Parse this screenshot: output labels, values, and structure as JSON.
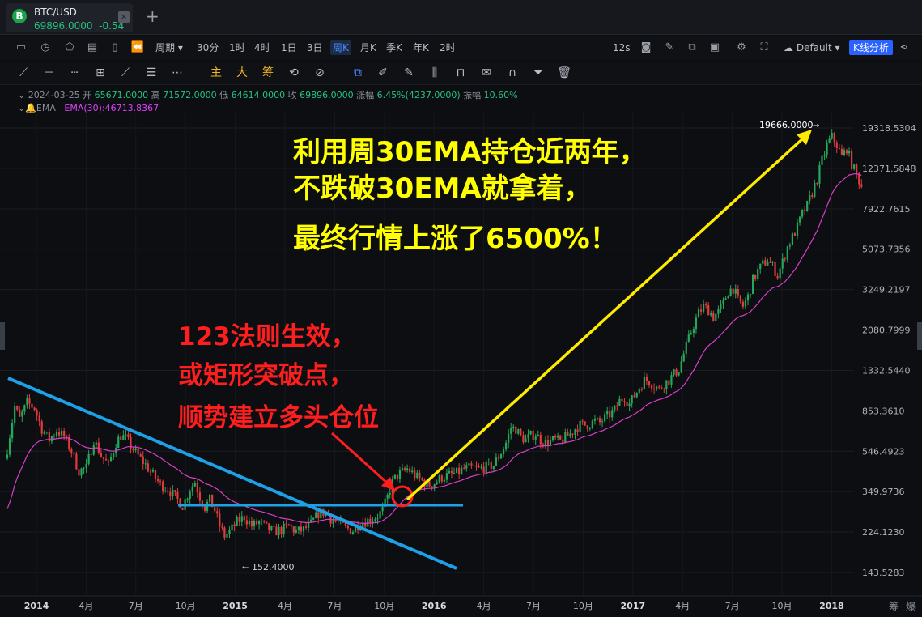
{
  "tab": {
    "symbol": "BTC/USD",
    "price": "69896.0000",
    "change": "-0.54",
    "logo": "B",
    "close": "×",
    "add": "+"
  },
  "toolbar1": {
    "period_label": "周期",
    "intervals": [
      "30分",
      "1时",
      "4时",
      "1日",
      "3日",
      "周K",
      "月K",
      "季K",
      "年K",
      "2时"
    ],
    "active_interval": "周K",
    "countdown": "12s",
    "theme": "Default",
    "kline_button": "K线分析"
  },
  "toolbar2": {
    "main": "主",
    "big": "大",
    "chip": "筹"
  },
  "ohlc": {
    "date": "2024-03-25",
    "open_label": "开",
    "open": "65671.0000",
    "high_label": "高",
    "high": "71572.0000",
    "low_label": "低",
    "low": "64614.0000",
    "close_label": "收",
    "close": "69896.0000",
    "change_label": "涨幅",
    "change": "6.45%(4237.0000)",
    "amp_label": "振幅",
    "amp": "10.60%"
  },
  "ema": {
    "name": "EMA",
    "value": "EMA(30):46713.8367",
    "color": "#e040fb"
  },
  "annotations": {
    "top_lines": [
      "利用周30EMA持仓近两年，",
      "不跌破30EMA就拿着，",
      "最终行情上涨了6500%！"
    ],
    "bottom_lines": [
      "123法则生效，",
      "或矩形突破点，",
      "顺势建立多头仓位"
    ],
    "peak_label": "19666.0000",
    "low_label": "152.4000"
  },
  "corner_labels": [
    "筹",
    "爆"
  ],
  "colors": {
    "up": "#26a85a",
    "down": "#e33b3b",
    "ema": "#d63fc7",
    "trendline": "#1ea0e6",
    "arrow_yellow": "#ffeb00",
    "arrow_red": "#ff1e1e"
  },
  "chart_data": {
    "type": "candlestick",
    "scale": "log",
    "interval": "weekly",
    "y_ticks": [
      19318.5304,
      12371.5848,
      7922.7615,
      5073.7356,
      3249.2197,
      2080.7999,
      1332.544,
      853.361,
      546.4923,
      349.9736,
      224.123,
      143.5283
    ],
    "x_ticks": [
      "2014",
      "4月",
      "7月",
      "10月",
      "2015",
      "4月",
      "7月",
      "10月",
      "2016",
      "4月",
      "7月",
      "10月",
      "2017",
      "4月",
      "7月",
      "10月",
      "2018"
    ],
    "close_series": [
      [
        0,
        560
      ],
      [
        3,
        890
      ],
      [
        5,
        780
      ],
      [
        8,
        930
      ],
      [
        11,
        880
      ],
      [
        14,
        700
      ],
      [
        17,
        620
      ],
      [
        20,
        690
      ],
      [
        23,
        640
      ],
      [
        26,
        545
      ],
      [
        29,
        440
      ],
      [
        32,
        455
      ],
      [
        35,
        620
      ],
      [
        38,
        520
      ],
      [
        41,
        470
      ],
      [
        44,
        600
      ],
      [
        46,
        650
      ],
      [
        48,
        630
      ],
      [
        50,
        580
      ],
      [
        53,
        520
      ],
      [
        56,
        470
      ],
      [
        59,
        420
      ],
      [
        62,
        380
      ],
      [
        65,
        360
      ],
      [
        68,
        330
      ],
      [
        71,
        300
      ],
      [
        74,
        360
      ],
      [
        76,
        390
      ],
      [
        78,
        330
      ],
      [
        80,
        295
      ],
      [
        82,
        320
      ],
      [
        84,
        285
      ],
      [
        86,
        240
      ],
      [
        88,
        215
      ],
      [
        90,
        225
      ],
      [
        93,
        250
      ],
      [
        96,
        265
      ],
      [
        99,
        240
      ],
      [
        102,
        250
      ],
      [
        105,
        235
      ],
      [
        108,
        225
      ],
      [
        111,
        230
      ],
      [
        114,
        240
      ],
      [
        117,
        225
      ],
      [
        120,
        230
      ],
      [
        123,
        245
      ],
      [
        126,
        275
      ],
      [
        129,
        280
      ],
      [
        131,
        260
      ],
      [
        134,
        250
      ],
      [
        137,
        235
      ],
      [
        140,
        228
      ],
      [
        142,
        245
      ],
      [
        144,
        250
      ],
      [
        146,
        255
      ],
      [
        148,
        260
      ],
      [
        150,
        268
      ],
      [
        152,
        285
      ],
      [
        154,
        330
      ],
      [
        156,
        390
      ],
      [
        158,
        420
      ],
      [
        160,
        435
      ],
      [
        162,
        450
      ],
      [
        164,
        430
      ],
      [
        166,
        410
      ],
      [
        168,
        395
      ],
      [
        170,
        375
      ],
      [
        173,
        385
      ],
      [
        176,
        410
      ],
      [
        179,
        420
      ],
      [
        182,
        430
      ],
      [
        185,
        450
      ],
      [
        188,
        455
      ],
      [
        191,
        450
      ],
      [
        194,
        460
      ],
      [
        197,
        470
      ],
      [
        200,
        540
      ],
      [
        202,
        600
      ],
      [
        204,
        710
      ],
      [
        206,
        700
      ],
      [
        208,
        640
      ],
      [
        210,
        620
      ],
      [
        212,
        650
      ],
      [
        214,
        660
      ],
      [
        216,
        620
      ],
      [
        218,
        600
      ],
      [
        220,
        610
      ],
      [
        222,
        620
      ],
      [
        224,
        610
      ],
      [
        226,
        640
      ],
      [
        228,
        660
      ],
      [
        230,
        700
      ],
      [
        232,
        730
      ],
      [
        234,
        730
      ],
      [
        236,
        740
      ],
      [
        238,
        760
      ],
      [
        240,
        750
      ],
      [
        242,
        790
      ],
      [
        244,
        820
      ],
      [
        246,
        860
      ],
      [
        248,
        950
      ],
      [
        250,
        1000
      ],
      [
        252,
        920
      ],
      [
        254,
        1010
      ],
      [
        256,
        1100
      ],
      [
        258,
        1200
      ],
      [
        260,
        1180
      ],
      [
        262,
        1130
      ],
      [
        264,
        1080
      ],
      [
        266,
        1150
      ],
      [
        268,
        1200
      ],
      [
        270,
        1280
      ],
      [
        272,
        1350
      ],
      [
        274,
        1600
      ],
      [
        276,
        1900
      ],
      [
        278,
        2200
      ],
      [
        280,
        2500
      ],
      [
        282,
        2700
      ],
      [
        284,
        2600
      ],
      [
        286,
        2400
      ],
      [
        288,
        2550
      ],
      [
        290,
        2800
      ],
      [
        292,
        3200
      ],
      [
        294,
        3300
      ],
      [
        296,
        2900
      ],
      [
        298,
        2700
      ],
      [
        300,
        3000
      ],
      [
        302,
        3600
      ],
      [
        304,
        4000
      ],
      [
        306,
        4300
      ],
      [
        308,
        4500
      ],
      [
        310,
        4200
      ],
      [
        312,
        3800
      ],
      [
        314,
        4400
      ],
      [
        316,
        5200
      ],
      [
        318,
        5800
      ],
      [
        320,
        6500
      ],
      [
        322,
        7500
      ],
      [
        324,
        8200
      ],
      [
        326,
        9500
      ],
      [
        328,
        11000
      ],
      [
        330,
        13500
      ],
      [
        332,
        16000
      ],
      [
        334,
        17500
      ],
      [
        336,
        16000
      ],
      [
        338,
        14000
      ],
      [
        340,
        15500
      ],
      [
        342,
        13000
      ],
      [
        344,
        11500
      ],
      [
        346,
        10200
      ]
    ]
  }
}
